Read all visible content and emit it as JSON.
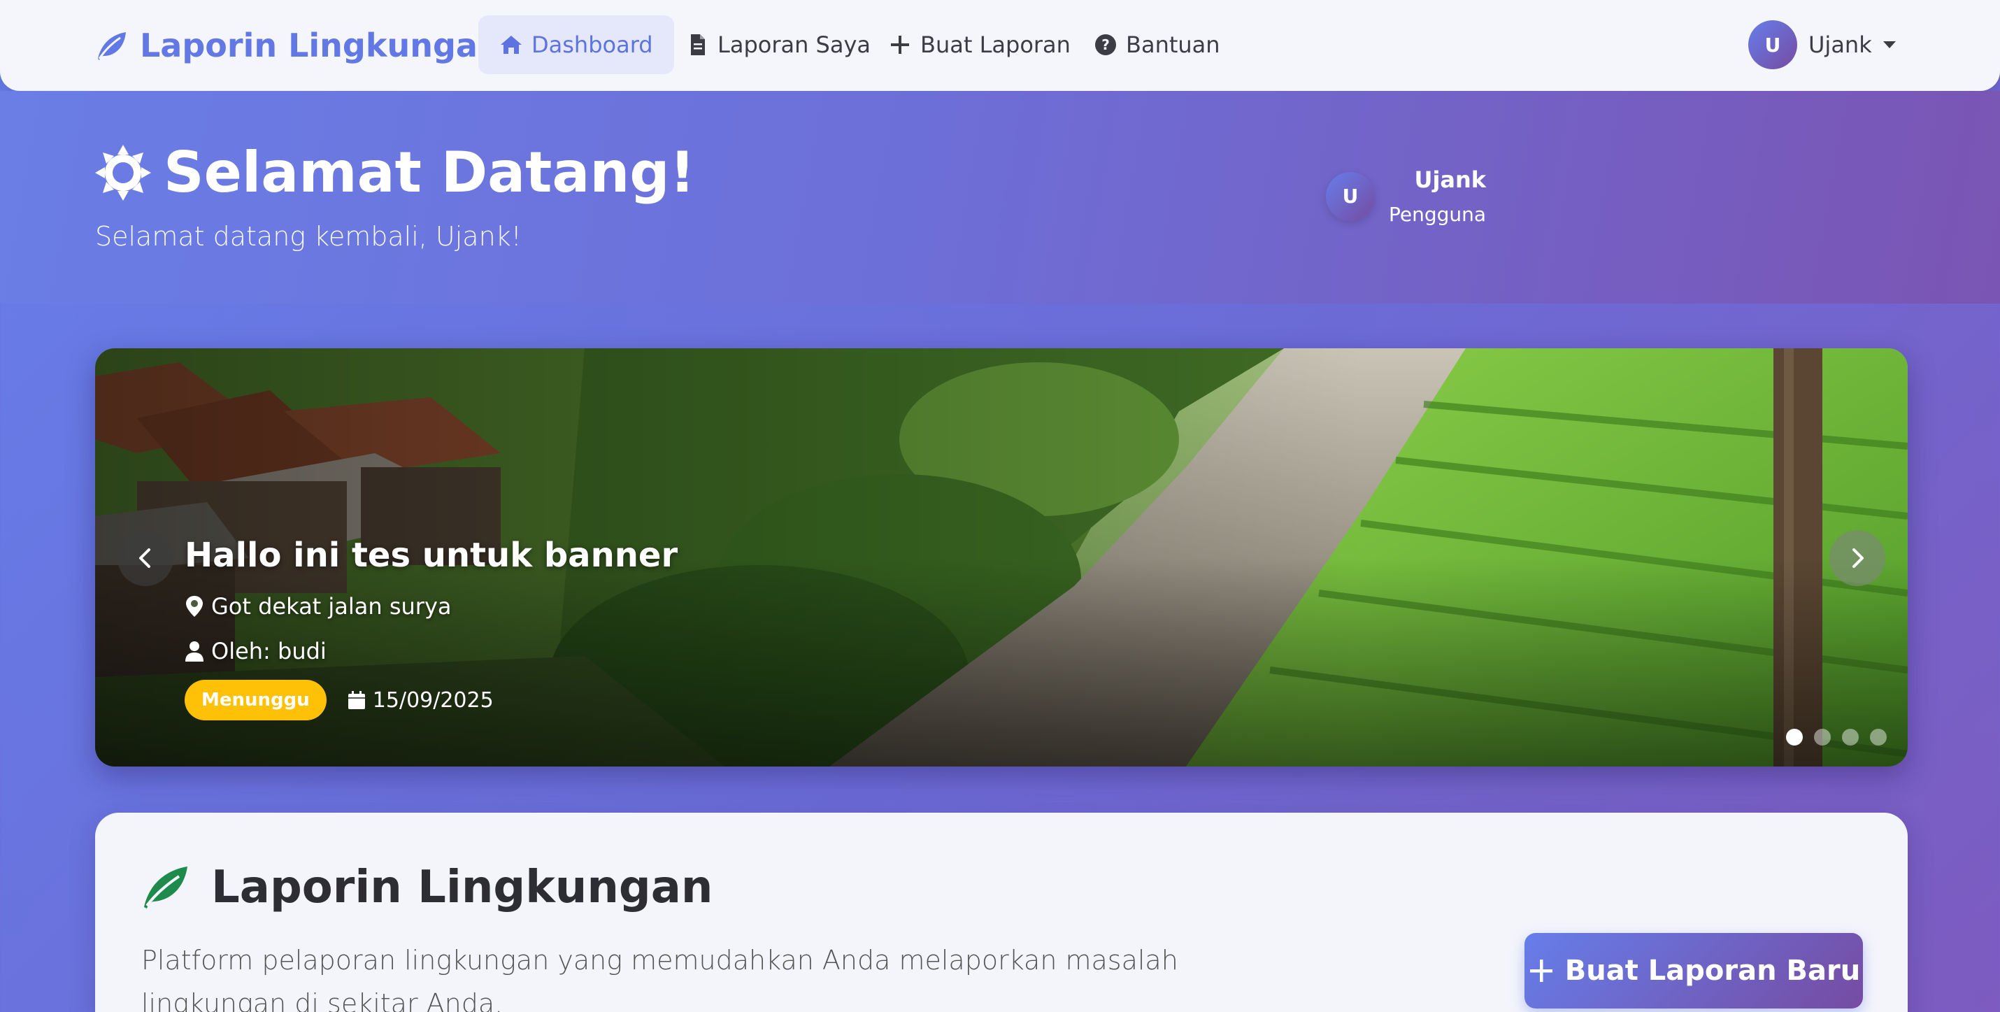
{
  "navbar": {
    "brand": "Laporin Lingkungan",
    "items": [
      {
        "label": "Dashboard",
        "icon": "home-icon",
        "active": true
      },
      {
        "label": "Laporan Saya",
        "icon": "document-icon"
      },
      {
        "label": "Buat Laporan",
        "icon": "plus-icon"
      },
      {
        "label": "Bantuan",
        "icon": "question-circle-icon"
      }
    ],
    "user": {
      "initial": "U",
      "name": "Ujank"
    }
  },
  "hero": {
    "title": "Selamat Datang!",
    "subtitle": "Selamat datang kembali, Ujank!",
    "user_initial": "U",
    "user_name": "Ujank",
    "user_role": "Pengguna"
  },
  "carousel": {
    "title": "Hallo ini tes untuk banner",
    "location": "Got dekat jalan surya",
    "author": "Oleh: budi",
    "status": "Menunggu",
    "status_color": "#ffc107",
    "date": "15/09/2025",
    "slide_count": 4,
    "active_slide": 1
  },
  "info": {
    "title": "Laporin Lingkungan",
    "description": "Platform pelaporan lingkungan yang memudahkan Anda melaporkan masalah lingkungan di sekitar Anda.",
    "cta_label": "Buat Laporan Baru"
  },
  "colors": {
    "accent": "#667eea",
    "accent_end": "#764ba2",
    "leaf_green": "#1e8a4c"
  }
}
